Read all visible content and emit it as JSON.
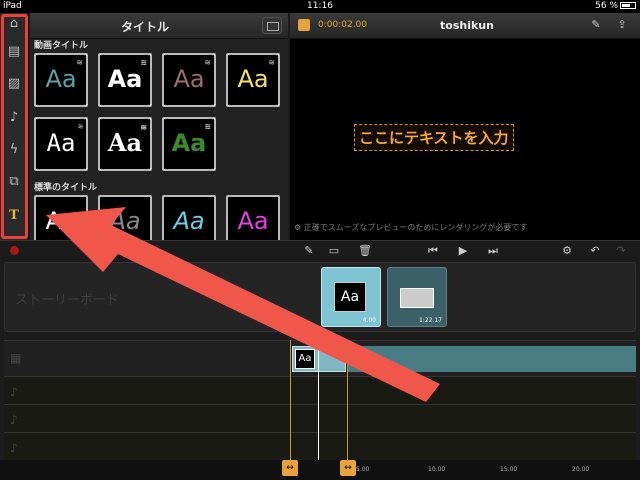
{
  "statusbar": {
    "device": "iPad",
    "time": "11:16",
    "battery": "56 %"
  },
  "sidebar": {
    "items": [
      {
        "icon": "home-icon",
        "glyph": "⌂"
      },
      {
        "icon": "filmstrip-icon",
        "glyph": "▤"
      },
      {
        "icon": "photo-icon",
        "glyph": "▨"
      },
      {
        "icon": "music-icon",
        "glyph": "♪"
      },
      {
        "icon": "transition-icon",
        "glyph": "ϟ"
      },
      {
        "icon": "overlay-icon",
        "glyph": "⧉"
      },
      {
        "icon": "title-icon",
        "glyph": "T"
      }
    ],
    "highlight_color": "#e8403a"
  },
  "titles_panel": {
    "title": "タイトル",
    "section_motion": "動画タイトル",
    "section_standard": "標準のタイトル",
    "thumb_text": "Aa",
    "motion_thumbs": [
      {
        "color": "#5fa0a6"
      },
      {
        "color": "#ffffff"
      },
      {
        "color": "#9a6e6e"
      },
      {
        "color": "#f2e46a"
      },
      {
        "color": "#ffffff"
      },
      {
        "color": "#ffffff"
      },
      {
        "color": "#3c8a2c"
      }
    ],
    "standard_thumbs": [
      {
        "color": "#ffffff"
      },
      {
        "color": "#888888"
      },
      {
        "color": "#6ad0e0"
      },
      {
        "color": "#e040e0"
      }
    ]
  },
  "preview": {
    "timecode": "0:00:02.00",
    "project_name": "toshikun",
    "overlay_text": "ここにテキストを入力",
    "render_note": "正確でスムーズなプレビューのためにレンダリングが必要です"
  },
  "storyboard": {
    "label": "ストーリーボード",
    "clips": [
      {
        "type": "title",
        "text": "Aa",
        "duration": "4.00"
      },
      {
        "type": "video",
        "duration": "1:22.17"
      }
    ]
  },
  "timeline": {
    "title_clip_text": "Aa",
    "ruler_ticks": [
      "5.00",
      "10.00",
      "15.00",
      "20.00"
    ]
  },
  "colors": {
    "accent": "#e8a33a",
    "annotation_arrow": "#f0564a"
  }
}
